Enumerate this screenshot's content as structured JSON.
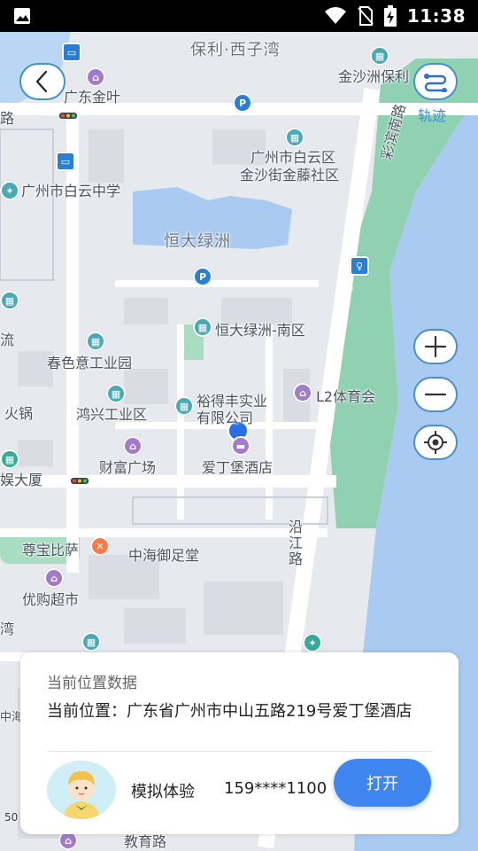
{
  "status_bar": {
    "time": "11:38",
    "icons": [
      "image-icon",
      "wifi-icon",
      "no-sim-icon",
      "battery-charging-icon"
    ]
  },
  "map": {
    "labels": {
      "baoli_xizi": "保利·西子湾",
      "jinshazhou_baoli": "金沙洲保利",
      "guangdong_jinye": "广东金叶",
      "lu_left": "路",
      "caibin_nanlu": "彩滨南路",
      "baiyun_jinsha_1": "广州市白云区",
      "baiyun_jinsha_2": "金沙街金藤社区",
      "baiyun_school": "广州市白云中学",
      "hengda_lvzhou": "恒大绿洲",
      "hengda_south": "恒大绿洲-南区",
      "liu": "流",
      "chunseyi": "春色意工业园",
      "huoguo": "火锅",
      "hongxing": "鸿兴工业区",
      "yudefeng_1": "裕得丰实业",
      "yudefeng_2": "有限公司",
      "l2_sports": "L2体育会",
      "caifu": "财富广场",
      "aidingbao": "爱丁堡酒店",
      "dasha": "娱大厦",
      "yanjiang_1": "沿",
      "yanjiang_2": "江",
      "yanjiang_3": "路",
      "zunbao": "尊宝比萨",
      "zhonghai": "中海御足堂",
      "yougou": "优购超市",
      "wan": "湾",
      "zhonghai_edge": "中海",
      "scale": "50",
      "bottom_road": "教育路"
    }
  },
  "controls": {
    "back_icon": "chevron-left-icon",
    "track_icon": "route-icon",
    "track_label": "轨迹",
    "zoom_in_icon": "plus-icon",
    "zoom_out_icon": "minus-icon",
    "locate_icon": "locate-icon"
  },
  "card": {
    "title": "当前位置数据",
    "address": "当前位置：广东省广州市中山五路219号爱丁堡酒店",
    "user_name": "模拟体验",
    "phone": "159****1100",
    "open_button": "打开"
  },
  "colors": {
    "accent": "#3f86f0",
    "water": "#a9cbf1",
    "park": "#8fd1b1",
    "road": "#ffffff",
    "block": "#dfe3e8"
  }
}
